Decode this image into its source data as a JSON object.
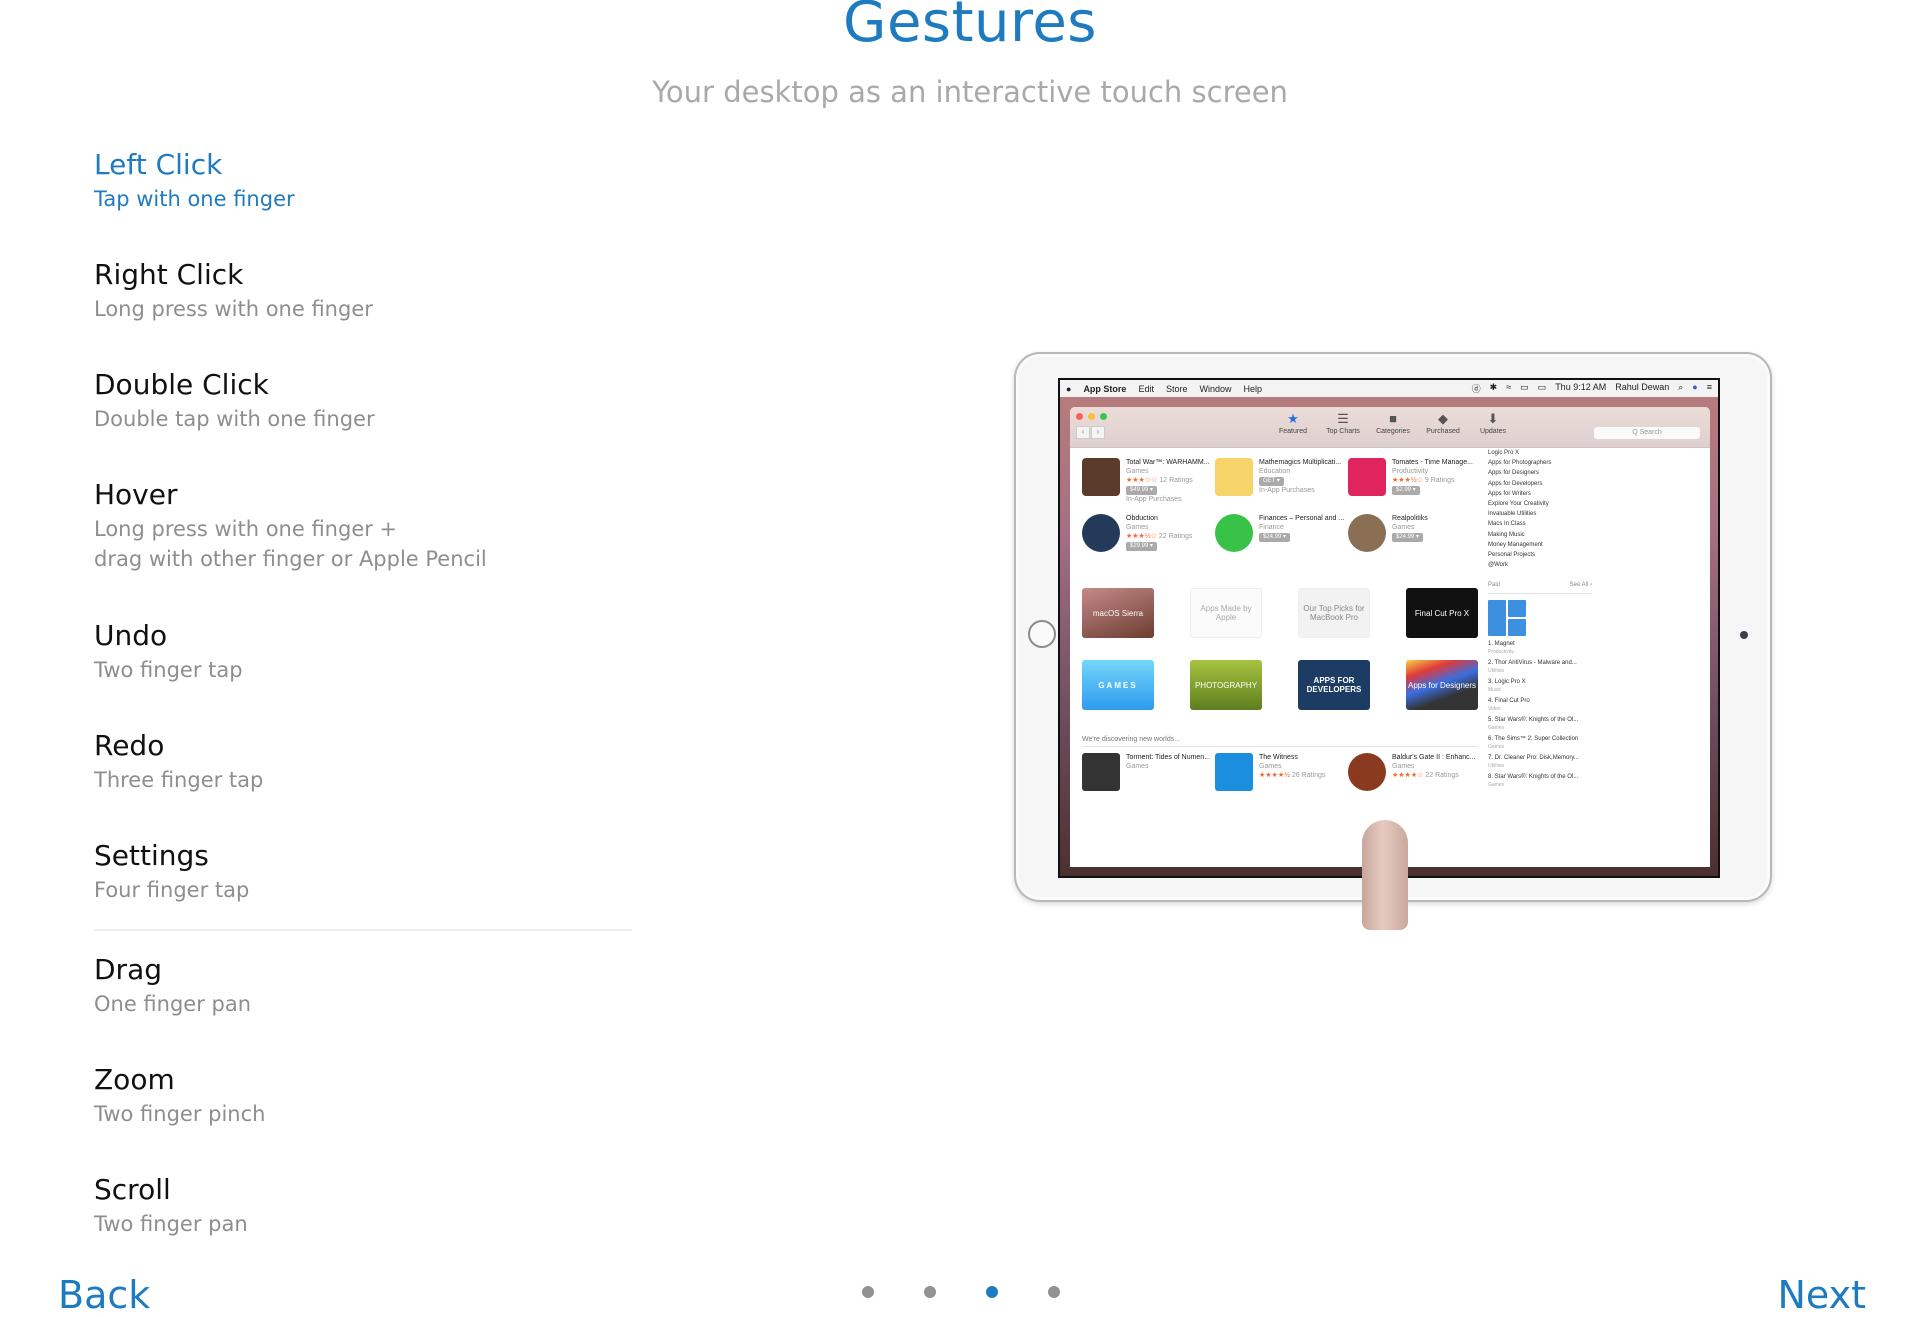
{
  "header": {
    "title": "Gestures",
    "subtitle": "Your desktop as an interactive touch screen"
  },
  "colors": {
    "accent": "#1f7bbf",
    "title_text": "#111111",
    "subtitle_text": "#8e8e8e"
  },
  "gestures": [
    {
      "title": "Left Click",
      "description": "Tap with one finger",
      "active": true
    },
    {
      "title": "Right Click",
      "description": "Long press with one finger"
    },
    {
      "title": "Double Click",
      "description": "Double tap with one finger"
    },
    {
      "title": "Hover",
      "description": "Long press with one finger +",
      "description2": "drag with other finger or Apple Pencil"
    },
    {
      "title": "Undo",
      "description": "Two finger tap"
    },
    {
      "title": "Redo",
      "description": "Three finger tap"
    },
    {
      "title": "Settings",
      "description": "Four finger tap"
    },
    {
      "title": "Drag",
      "description": "One finger pan"
    },
    {
      "title": "Zoom",
      "description": "Two finger pinch"
    },
    {
      "title": "Scroll",
      "description": "Two finger pan"
    }
  ],
  "preview": {
    "menubar": {
      "apple": "",
      "app": "App Store",
      "menus": [
        "Edit",
        "Store",
        "Window",
        "Help"
      ],
      "status_icons": [
        "ⓓ",
        "✱",
        "≈",
        "▭",
        "▭"
      ],
      "clock": "Thu 9:12 AM",
      "user": "Rahul Dewan",
      "search_icon": "⌕",
      "list_icon": "≡"
    },
    "toolbar": {
      "back": "‹",
      "forward": "›",
      "items": [
        {
          "icon": "★",
          "label": "Featured"
        },
        {
          "icon": "☰",
          "label": "Top Charts"
        },
        {
          "icon": "■",
          "label": "Categories"
        },
        {
          "icon": "◆",
          "label": "Purchased"
        },
        {
          "icon": "⬇",
          "label": "Updates"
        }
      ],
      "search_placeholder": "Q Search"
    },
    "apps": [
      {
        "name": "Total War™: WARHAMM...",
        "category": "Games",
        "stars": "★★★☆☆",
        "ratings": "12 Ratings",
        "price": "$49.99",
        "note": "In-App Purchases"
      },
      {
        "name": "Mathemagics Multiplicati...",
        "category": "Education",
        "stars": "",
        "ratings": "",
        "price": "GET",
        "note": "In-App Purchases"
      },
      {
        "name": "Tomates - Time Manage...",
        "category": "Productivity",
        "stars": "★★★½☆",
        "ratings": "9 Ratings",
        "price": "$2.99",
        "note": ""
      },
      {
        "name": "Obduction",
        "category": "Games",
        "stars": "★★★½☆",
        "ratings": "22 Ratings",
        "price": "$29.99",
        "note": ""
      },
      {
        "name": "Finances – Personal and ...",
        "category": "Finance",
        "stars": "",
        "ratings": "",
        "price": "$24.99",
        "note": ""
      },
      {
        "name": "Realpolitiks",
        "category": "Games",
        "stars": "",
        "ratings": "",
        "price": "$24.99",
        "note": ""
      }
    ],
    "banners": [
      {
        "label": "macOS Sierra"
      },
      {
        "label": "Apps Made by Apple"
      },
      {
        "label": "Our Top Picks for MacBook Pro"
      },
      {
        "label": "Final Cut Pro X"
      },
      {
        "label": "GAMES"
      },
      {
        "label": "PHOTOGRAPHY"
      },
      {
        "label": "APPS FOR DEVELOPERS"
      },
      {
        "label": "Apps for Designers"
      }
    ],
    "section_label": "We're discovering new worlds...",
    "bottom_apps": [
      {
        "name": "Torment: Tides of Numen...",
        "category": "Games",
        "stars": "",
        "ratings": ""
      },
      {
        "name": "The Witness",
        "category": "Games",
        "stars": "★★★★½",
        "ratings": "26 Ratings"
      },
      {
        "name": "Baldur's Gate II : Enhanc...",
        "category": "Games",
        "stars": "★★★★☆",
        "ratings": "22 Ratings"
      }
    ],
    "sidebar_links": [
      "Logic Pro X",
      "Apps for Photographers",
      "Apps for Designers",
      "Apps for Developers",
      "Apps for Writers",
      "Explore Your Creativity",
      "Invaluable Utilities",
      "Macs In Class",
      "Making Music",
      "Money Management",
      "Personal Projects",
      "@Work"
    ],
    "paid_label": "Paid",
    "see_all": "See All ›",
    "top_paid": [
      {
        "rank": "1.",
        "name": "Magnet",
        "category": "Productivity"
      },
      {
        "rank": "2.",
        "name": "Thor AntiVirus - Malware and...",
        "category": "Utilities"
      },
      {
        "rank": "3.",
        "name": "Logic Pro X",
        "category": "Music"
      },
      {
        "rank": "4.",
        "name": "Final Cut Pro",
        "category": "Video"
      },
      {
        "rank": "5.",
        "name": "Star Wars®: Knights of the Ol...",
        "category": "Games"
      },
      {
        "rank": "6.",
        "name": "The Sims™ 2: Super Collection",
        "category": "Games"
      },
      {
        "rank": "7.",
        "name": "Dr. Cleaner Pro: Disk,Memory...",
        "category": "Utilities"
      },
      {
        "rank": "8.",
        "name": "Star Wars®: Knights of the Ol...",
        "category": "Games"
      }
    ]
  },
  "footer": {
    "back_label": "Back",
    "next_label": "Next",
    "page_count": 4,
    "current_page": 3
  }
}
